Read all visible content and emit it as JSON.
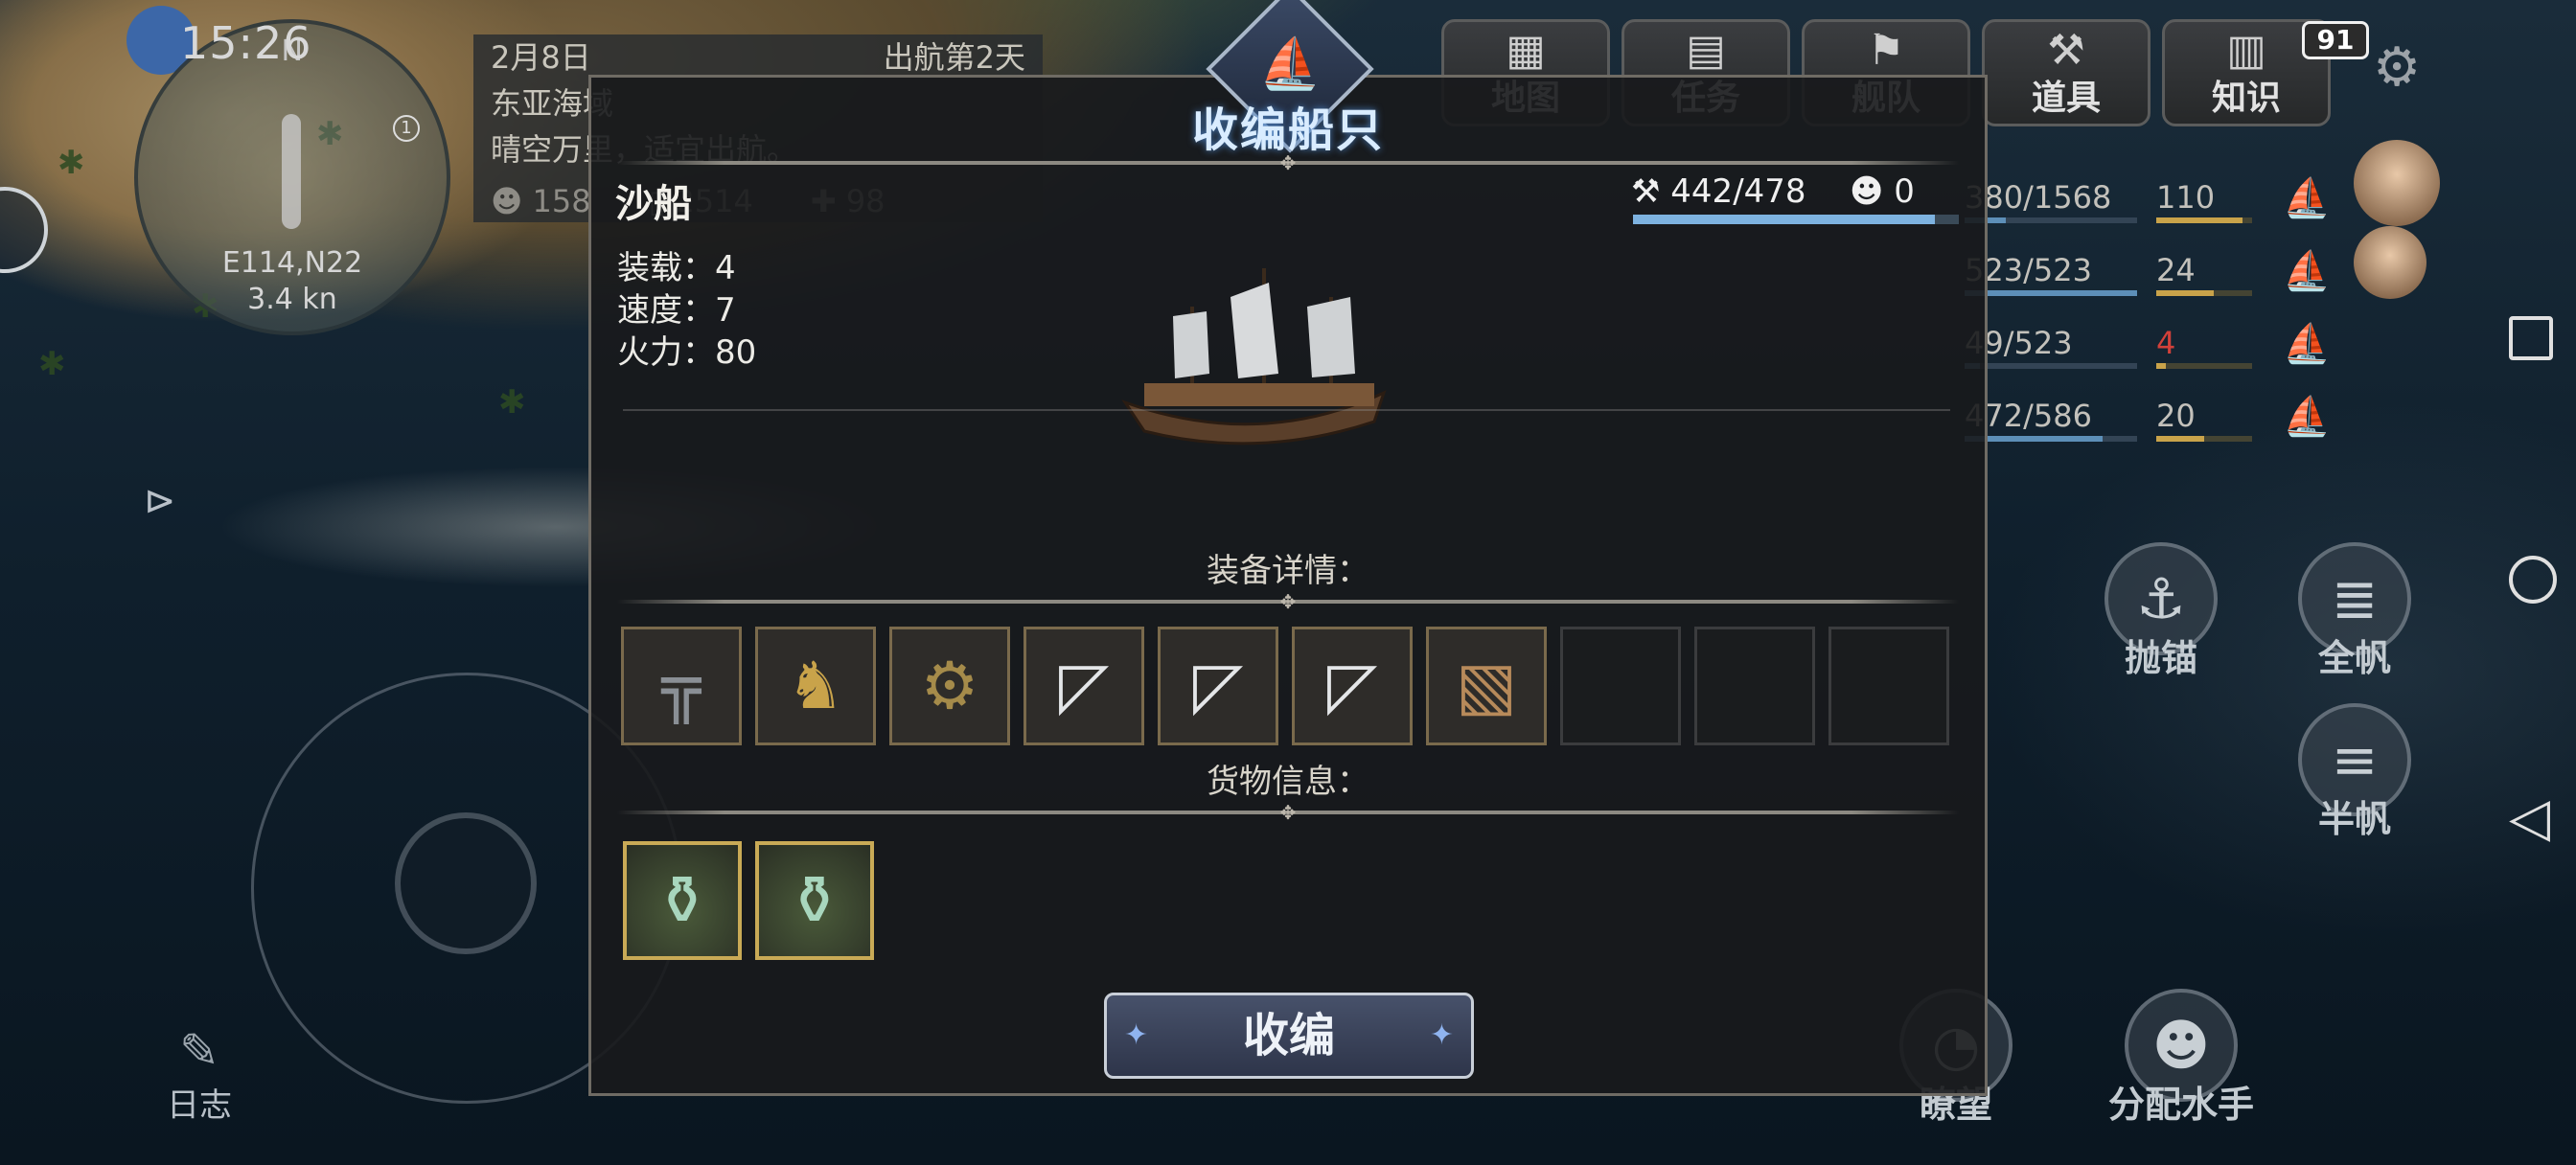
{
  "status_bar": {
    "time": "15:26",
    "battery": "91"
  },
  "minimap": {
    "north": "N",
    "marker_count": "1",
    "coords": "E114,N22",
    "speed": "3.4 kn"
  },
  "voyage": {
    "date": "2月8日",
    "days": "出航第2天",
    "region": "东亚海域",
    "weather": "晴空万里，适宜出航。",
    "stat_crew": "158",
    "stat_food": "2514",
    "stat_health": "98"
  },
  "top_menu": [
    {
      "label": "地图",
      "icon": "map-icon"
    },
    {
      "label": "任务",
      "icon": "scroll-icon"
    },
    {
      "label": "舰队",
      "icon": "flag-icon"
    },
    {
      "label": "道具",
      "icon": "tools-icon"
    },
    {
      "label": "知识",
      "icon": "book-icon"
    }
  ],
  "fleet": [
    {
      "durability": "380/1568",
      "dur_pct": 0.24,
      "crew": "110",
      "crew_pct": 0.9
    },
    {
      "durability": "523/523",
      "dur_pct": 1.0,
      "crew": "24",
      "crew_pct": 0.6
    },
    {
      "durability": "49/523",
      "dur_pct": 0.09,
      "crew": "4",
      "crew_pct": 0.1
    },
    {
      "durability": "472/586",
      "dur_pct": 0.8,
      "crew": "20",
      "crew_pct": 0.5
    }
  ],
  "actions": {
    "anchor": "抛锚",
    "full_sail": "全帆",
    "half_sail": "半帆",
    "lookout": "瞭望",
    "assign_sailors": "分配水手",
    "log": "日志"
  },
  "dialog": {
    "title": "收编船只",
    "ship_name": "沙船",
    "capacity": "装载：4",
    "speed": "速度：7",
    "firepower": "火力：80",
    "durability": "442/478",
    "durability_pct": 0.925,
    "sailors": "0",
    "equipment_label": "装备详情：",
    "cargo_label": "货物信息：",
    "equipment": [
      {
        "name": "cannon-icon"
      },
      {
        "name": "dragon-figurehead-icon"
      },
      {
        "name": "field-gun-icon"
      },
      {
        "name": "sail-icon"
      },
      {
        "name": "sail-icon"
      },
      {
        "name": "sail-icon"
      },
      {
        "name": "armor-plate-icon"
      },
      {
        "name": "empty"
      },
      {
        "name": "empty"
      },
      {
        "name": "empty"
      }
    ],
    "cargo": [
      {
        "name": "celadon-vase-icon"
      },
      {
        "name": "celadon-vase-icon"
      }
    ],
    "confirm_label": "收编"
  }
}
